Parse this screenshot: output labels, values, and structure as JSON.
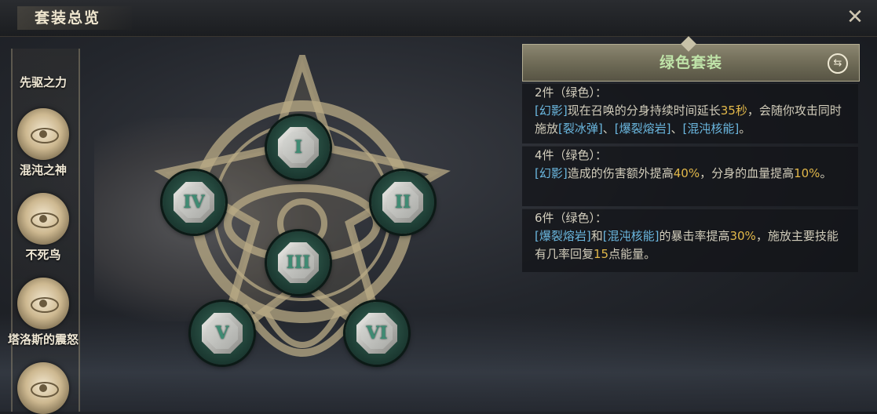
{
  "header": {
    "title": "套装总览"
  },
  "sidebar": {
    "items": [
      {
        "label": "先驱之力"
      },
      {
        "label": "混沌之神"
      },
      {
        "label": "不死鸟"
      },
      {
        "label": "塔洛斯的震怒"
      },
      {
        "label": ""
      }
    ]
  },
  "gems": [
    {
      "numeral": "I"
    },
    {
      "numeral": "II"
    },
    {
      "numeral": "III"
    },
    {
      "numeral": "IV"
    },
    {
      "numeral": "V"
    },
    {
      "numeral": "VI"
    }
  ],
  "panel": {
    "title": "绿色套装",
    "bonuses": [
      {
        "head": "2件（绿色）：",
        "parts": [
          {
            "t": "[幻影]",
            "c": "tag"
          },
          {
            "t": "现在召唤的分身持续时间延长",
            "c": ""
          },
          {
            "t": "35秒",
            "c": "hl"
          },
          {
            "t": "，会随你攻击同时施放",
            "c": ""
          },
          {
            "t": "[裂冰弹]",
            "c": "tag"
          },
          {
            "t": "、",
            "c": ""
          },
          {
            "t": "[爆裂熔岩]",
            "c": "tag"
          },
          {
            "t": "、",
            "c": ""
          },
          {
            "t": "[混沌核能]",
            "c": "tag"
          },
          {
            "t": "。",
            "c": ""
          }
        ]
      },
      {
        "head": "4件（绿色）：",
        "parts": [
          {
            "t": "[幻影]",
            "c": "tag"
          },
          {
            "t": "造成的伤害额外提高",
            "c": ""
          },
          {
            "t": "40%",
            "c": "hl"
          },
          {
            "t": "，分身的血量提高",
            "c": ""
          },
          {
            "t": "10%",
            "c": "hl"
          },
          {
            "t": "。",
            "c": ""
          }
        ]
      },
      {
        "head": "6件（绿色）：",
        "parts": [
          {
            "t": "[爆裂熔岩]",
            "c": "tag"
          },
          {
            "t": "和",
            "c": ""
          },
          {
            "t": "[混沌核能]",
            "c": "tag"
          },
          {
            "t": "的暴击率提高",
            "c": ""
          },
          {
            "t": "30%",
            "c": "hl"
          },
          {
            "t": "，施放主要技能有几率回复",
            "c": ""
          },
          {
            "t": "15",
            "c": "hl"
          },
          {
            "t": "点能量。",
            "c": ""
          }
        ]
      }
    ]
  },
  "colors": {
    "title_green": "#bfe3a8",
    "skill_tag_blue": "#6bb8e0",
    "highlight_gold": "#e2b84a",
    "gem_numeral_green": "#3f8b73"
  },
  "icons": {
    "close": "close-x-icon",
    "swap": "swap-arrows-icon"
  }
}
